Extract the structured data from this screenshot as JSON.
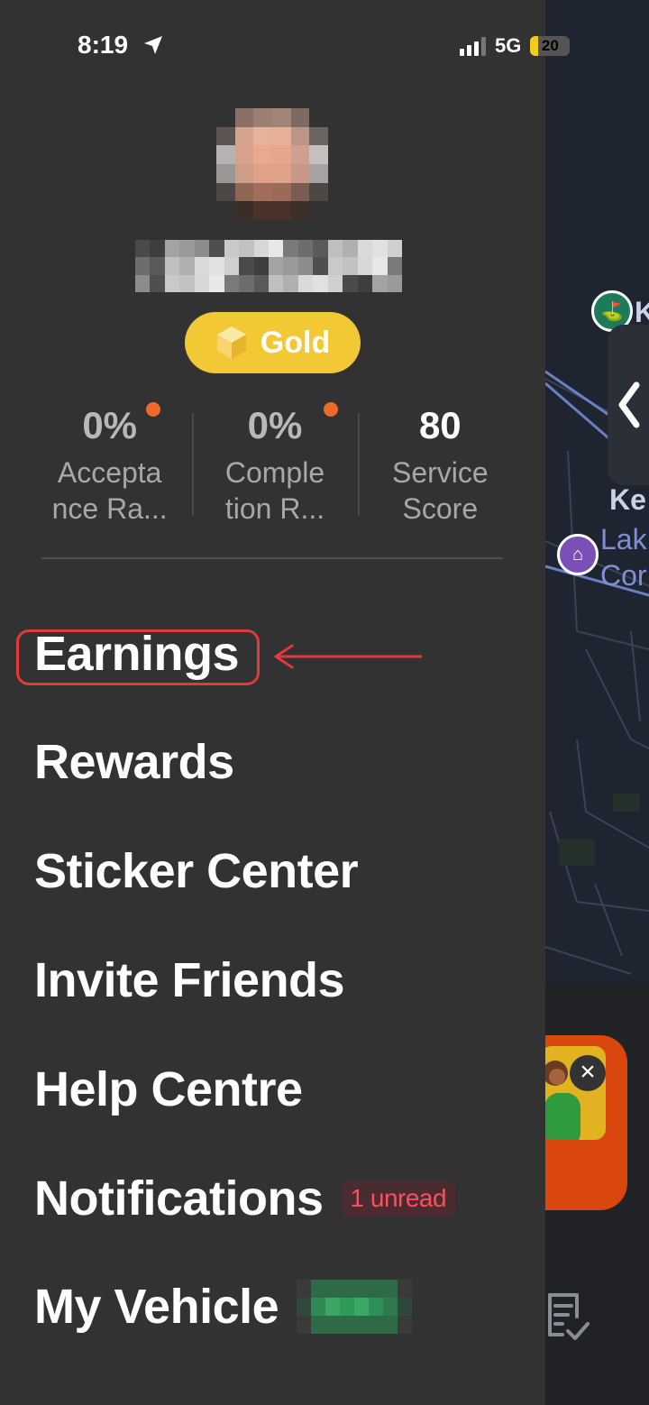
{
  "status_bar": {
    "time": "8:19",
    "network": "5G",
    "battery": 20,
    "icons": [
      "location-arrow-icon",
      "cellular-signal-icon",
      "battery-icon"
    ]
  },
  "map": {
    "labels": [
      "K",
      "Ke",
      "Lak",
      "Cor"
    ]
  },
  "drawer": {
    "tier": {
      "label": "Gold",
      "icon": "hexagon-gem-icon"
    },
    "stats": [
      {
        "value": "0%",
        "label_line1": "Accepta",
        "label_line2": "nce Ra...",
        "has_alert_dot": true
      },
      {
        "value": "0%",
        "label_line1": "Comple",
        "label_line2": "tion R...",
        "has_alert_dot": true
      },
      {
        "value": "80",
        "label_line1": "Service",
        "label_line2": "Score",
        "has_alert_dot": false
      }
    ],
    "menu": [
      {
        "label": "Earnings"
      },
      {
        "label": "Rewards"
      },
      {
        "label": "Sticker Center"
      },
      {
        "label": "Invite Friends"
      },
      {
        "label": "Help Centre"
      },
      {
        "label": "Notifications",
        "badge": "1 unread"
      },
      {
        "label": "My Vehicle"
      }
    ]
  },
  "colors": {
    "drawer_bg": "#323233",
    "tier_gold": "#f2c935",
    "alert_dot": "#ee6a2c",
    "badge_text": "#ff4d5e",
    "annotation_red": "#e03a3a",
    "map_bg": "#1e2530"
  }
}
